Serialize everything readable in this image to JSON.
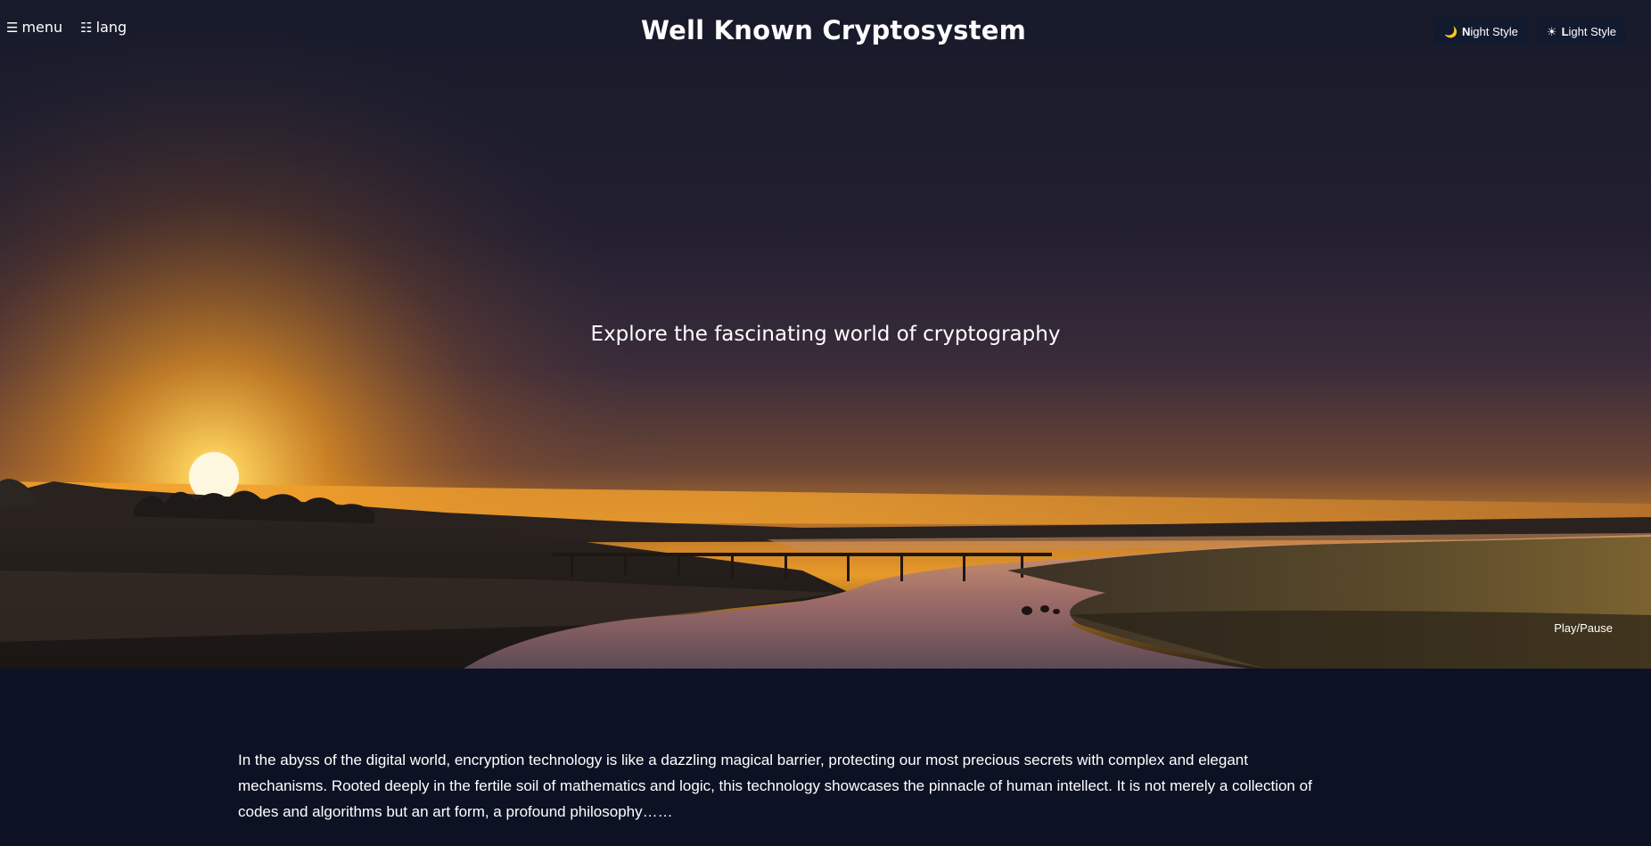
{
  "header": {
    "menu_label": "menu",
    "menu_glyph": "☰",
    "lang_label": "lang",
    "lang_glyph": "☷",
    "title": "Well Known Cryptosystem",
    "night_style": {
      "icon": "moon-icon",
      "glyph": "🌙",
      "first": "N",
      "rest": "ight Style"
    },
    "light_style": {
      "icon": "sun-icon",
      "glyph": "☀",
      "first": "L",
      "rest": "ight Style"
    }
  },
  "hero": {
    "tagline": "Explore the fascinating world of cryptography",
    "play_pause_label": "Play/Pause",
    "image": "sunset-river-landscape"
  },
  "main": {
    "intro_text": "In the abyss of the digital world, encryption technology is like a dazzling magical barrier, protecting our most precious secrets with complex and elegant mechanisms. Rooted deeply in the fertile soil of mathematics and logic, this technology showcases the pinnacle of human intellect. It is not merely a collection of codes and algorithms but an art form, a profound philosophy……"
  },
  "colors": {
    "page_background": "#0c1224",
    "sky_top": "#1c1c2e",
    "sun_glow": "#f7a21b",
    "text": "#ffffff"
  }
}
